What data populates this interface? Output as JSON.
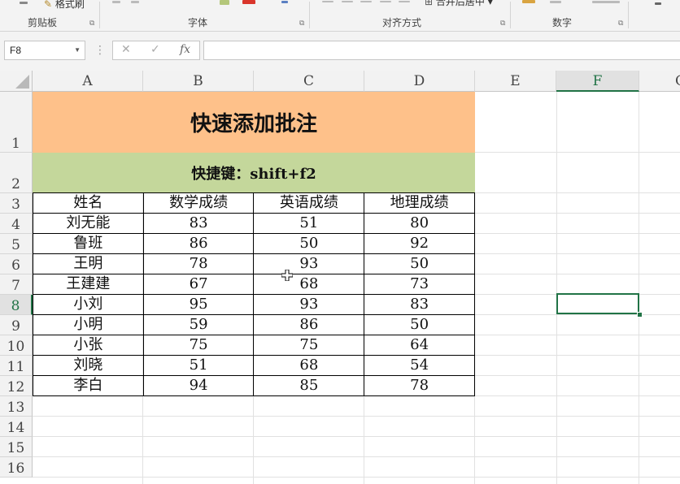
{
  "ribbon": {
    "format_painter_label": "格式刷",
    "groups": [
      {
        "name": "剪贴板"
      },
      {
        "name": "字体"
      },
      {
        "name": "对齐方式"
      },
      {
        "name": "数字"
      }
    ],
    "merge_label": "合并后居中"
  },
  "formula_bar": {
    "name_box": "F8",
    "cancel_icon": "✕",
    "enter_icon": "✓",
    "fx_label": "fx",
    "formula": ""
  },
  "columns": [
    "A",
    "B",
    "C",
    "D",
    "E",
    "F",
    "G"
  ],
  "rows": [
    "1",
    "2",
    "3",
    "4",
    "5",
    "6",
    "7",
    "8",
    "9",
    "10",
    "11",
    "12",
    "13",
    "14",
    "15",
    "16"
  ],
  "sheet": {
    "title": "快速添加批注",
    "shortcut": "快捷键：shift+f2",
    "headers": [
      "姓名",
      "数学成绩",
      "英语成绩",
      "地理成绩"
    ],
    "records": [
      [
        "刘无能",
        "83",
        "51",
        "80"
      ],
      [
        "鲁班",
        "86",
        "50",
        "92"
      ],
      [
        "王明",
        "78",
        "93",
        "50"
      ],
      [
        "王建建",
        "67",
        "68",
        "73"
      ],
      [
        "小刘",
        "95",
        "93",
        "83"
      ],
      [
        "小明",
        "59",
        "86",
        "50"
      ],
      [
        "小张",
        "75",
        "75",
        "64"
      ],
      [
        "刘晓",
        "51",
        "68",
        "54"
      ],
      [
        "李白",
        "94",
        "85",
        "78"
      ]
    ]
  },
  "selection": {
    "cell": "F8",
    "accent_color": "#217346"
  },
  "colors": {
    "title_fill": "#fec18a",
    "subtitle_fill": "#c4d79b"
  }
}
